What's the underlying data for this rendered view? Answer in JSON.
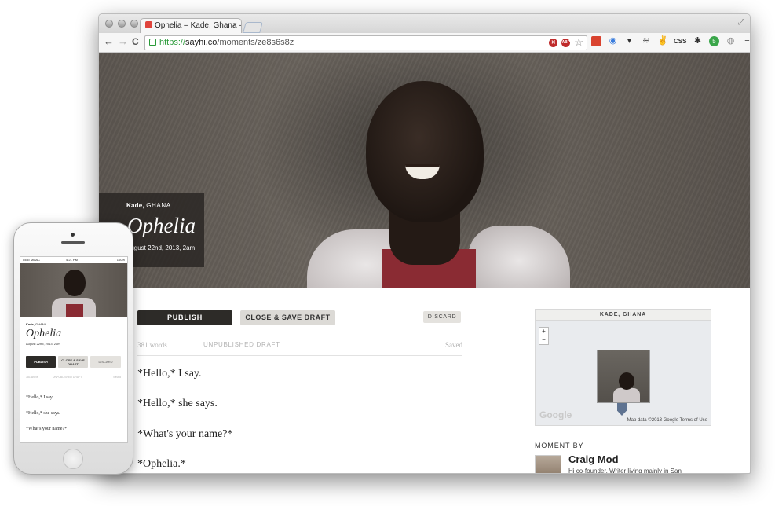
{
  "browser": {
    "tab_title": "Ophelia – Kade, Ghana — ",
    "tab_close": "×",
    "url_scheme": "https://",
    "url_host": "sayhi.co",
    "url_path": "/moments/ze8s6s8z",
    "back_glyph": "←",
    "forward_glyph": "→",
    "reload_glyph": "C",
    "abp_label": "ABP",
    "star_glyph": "☆",
    "css_label": "CSS",
    "menu_glyph": "≡"
  },
  "moment": {
    "location_city": "Kade,",
    "location_country": "GHANA",
    "title": "Ophelia",
    "date": "August 22nd, 2013, 2am"
  },
  "actions": {
    "publish": "PUBLISH",
    "close_save": "CLOSE & SAVE DRAFT",
    "discard": "DISCARD"
  },
  "status": {
    "words": "381 words",
    "state": "UNPUBLISHED DRAFT",
    "saved": "Saved"
  },
  "body": {
    "paragraphs": [
      "*Hello,* I say.",
      "*Hello,* she says.",
      "*What's your name?*",
      "*Ophelia.*"
    ]
  },
  "map": {
    "title": "KADE, GHANA",
    "zoom_in": "+",
    "zoom_out": "−",
    "logo": "Google",
    "attribution": "Map data ©2013 Google   Terms of Use"
  },
  "author": {
    "heading": "MOMENT BY",
    "name": "Craig Mod",
    "bio": "Hi co-founder. Writer living mainly in San"
  },
  "phone": {
    "carrier": "•••oo MMAC",
    "time": "4:21 PM",
    "battery": "100%",
    "location_city": "Kade,",
    "location_country": "GHANA",
    "title": "Ophelia",
    "date": "August 22nd, 2013, 2am",
    "publish": "PUBLISH",
    "close_save": "CLOSE & SAVE DRAFT",
    "discard": "DISCARD",
    "words": "381 words",
    "state": "UNPUBLISHED DRAFT",
    "saved": "Saved",
    "paragraphs": [
      "*Hello,* I say.",
      "*Hello,* she says.",
      "*What's your name?*"
    ]
  },
  "colors": {
    "dark_button": "#2d2b28",
    "light_button": "#dcdad6",
    "secure_green": "#2b9b3a",
    "map_pin": "#5f7391"
  },
  "icons": {
    "tab_favicon": "sayhi-favicon",
    "secure": "lock-icon",
    "bookmark": "star-icon",
    "map_marker": "map-pin-icon"
  }
}
